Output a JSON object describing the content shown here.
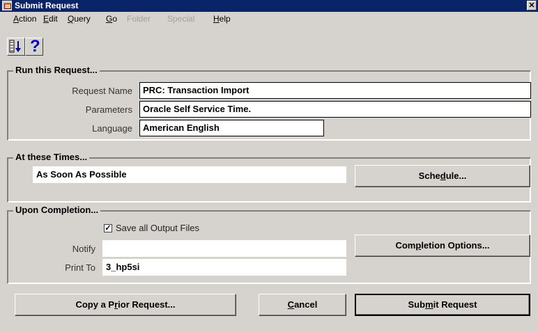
{
  "window": {
    "title": "Submit Request"
  },
  "menu": [
    {
      "label": "Action",
      "mnemonic": "A",
      "enabled": true
    },
    {
      "label": "Edit",
      "mnemonic": "E",
      "enabled": true
    },
    {
      "label": "Query",
      "mnemonic": "Q",
      "enabled": true
    },
    {
      "label": "Go",
      "mnemonic": "G",
      "enabled": true
    },
    {
      "label": "Folder",
      "mnemonic": "",
      "enabled": false
    },
    {
      "label": "Special",
      "mnemonic": "",
      "enabled": false
    },
    {
      "label": "Help",
      "mnemonic": "H",
      "enabled": true
    }
  ],
  "toolbar": {
    "icons": [
      "list-of-values-icon",
      "help-icon"
    ],
    "help_glyph": "?"
  },
  "run": {
    "title": "Run this Request...",
    "request_name_label": "Request Name",
    "request_name": "PRC: Transaction Import",
    "parameters_label": "Parameters",
    "parameters": "Oracle Self Service Time.",
    "language_label": "Language",
    "language": "American English"
  },
  "times": {
    "title": "At these Times...",
    "value": "As Soon As Possible",
    "schedule_label": "Schedule..."
  },
  "completion": {
    "title": "Upon Completion...",
    "save_label": "Save all Output Files",
    "save_checked": true,
    "notify_label": "Notify",
    "notify": "",
    "print_label": "Print To",
    "print_to": "3_hp5si",
    "options_label": "Completion Options..."
  },
  "buttons": {
    "copy": "Copy a Prior Request...",
    "cancel": "Cancel",
    "submit": "Submit Request"
  },
  "colors": {
    "titlebar": "#0a246a",
    "background": "#d6d3ce",
    "disabled_text": "#a0a0a0"
  }
}
